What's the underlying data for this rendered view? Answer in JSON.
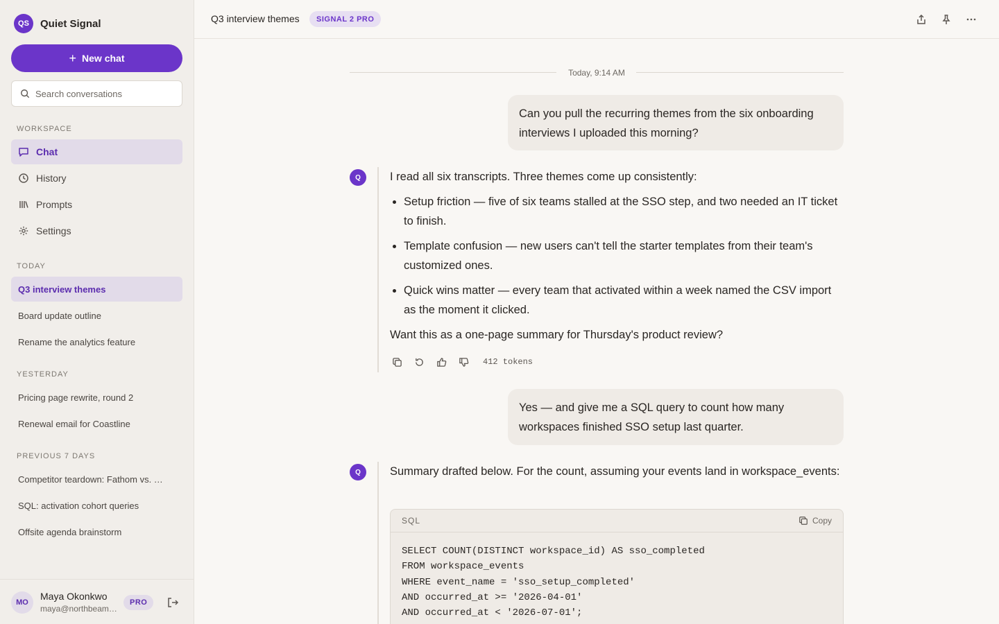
{
  "brand": {
    "logo": "QS",
    "name": "Quiet Signal"
  },
  "sidebar": {
    "new_chat_label": "New chat",
    "search_placeholder": "Search conversations",
    "workspace_label": "WORKSPACE",
    "nav": [
      {
        "label": "Chat",
        "icon": "chat-bubble-icon",
        "active": true
      },
      {
        "label": "History",
        "icon": "clock-icon"
      },
      {
        "label": "Prompts",
        "icon": "library-icon"
      },
      {
        "label": "Settings",
        "icon": "gear-icon"
      }
    ],
    "sections": [
      {
        "label": "TODAY",
        "items": [
          "Q3 interview themes",
          "Board update outline",
          "Rename the analytics feature"
        ]
      },
      {
        "label": "YESTERDAY",
        "items": [
          "Pricing page rewrite, round 2",
          "Renewal email for Coastline"
        ]
      },
      {
        "label": "PREVIOUS 7 DAYS",
        "items": [
          "Competitor teardown: Fathom vs. …",
          "SQL: activation cohort queries",
          "Offsite agenda brainstorm"
        ]
      }
    ],
    "active_conversation": "Q3 interview themes"
  },
  "user": {
    "initials": "MO",
    "name": "Maya Okonkwo",
    "email": "maya@northbeam.…",
    "plan": "PRO"
  },
  "header": {
    "title": "Q3 interview themes",
    "model": "SIGNAL 2 PRO"
  },
  "thread": {
    "date": "Today, 9:14 AM",
    "assistant_initial": "Q",
    "msg1_user": "Can you pull the recurring themes from the six onboarding interviews I uploaded this morning?",
    "msg2": {
      "intro": "I read all six transcripts. Three themes come up consistently:",
      "bullets": [
        "Setup friction — five of six teams stalled at the SSO step, and two needed an IT ticket to finish.",
        "Template confusion — new users can't tell the starter templates from their team's customized ones.",
        "Quick wins matter — every team that activated within a week named the CSV import as the moment it clicked."
      ],
      "outro": "Want this as a one-page summary for Thursday's product review?",
      "tokens": "412 tokens"
    },
    "msg3_user": "Yes — and give me a SQL query to count how many workspaces finished SSO setup last quarter.",
    "msg4": {
      "text": "Summary drafted below. For the count, assuming your events land in workspace_events:",
      "code_lang": "SQL",
      "copy_label": "Copy",
      "code": "SELECT COUNT(DISTINCT workspace_id) AS sso_completed\nFROM workspace_events\nWHERE event_name = 'sso_setup_completed'\nAND occurred_at >= '2026-04-01'\nAND occurred_at < '2026-07-01';"
    }
  }
}
